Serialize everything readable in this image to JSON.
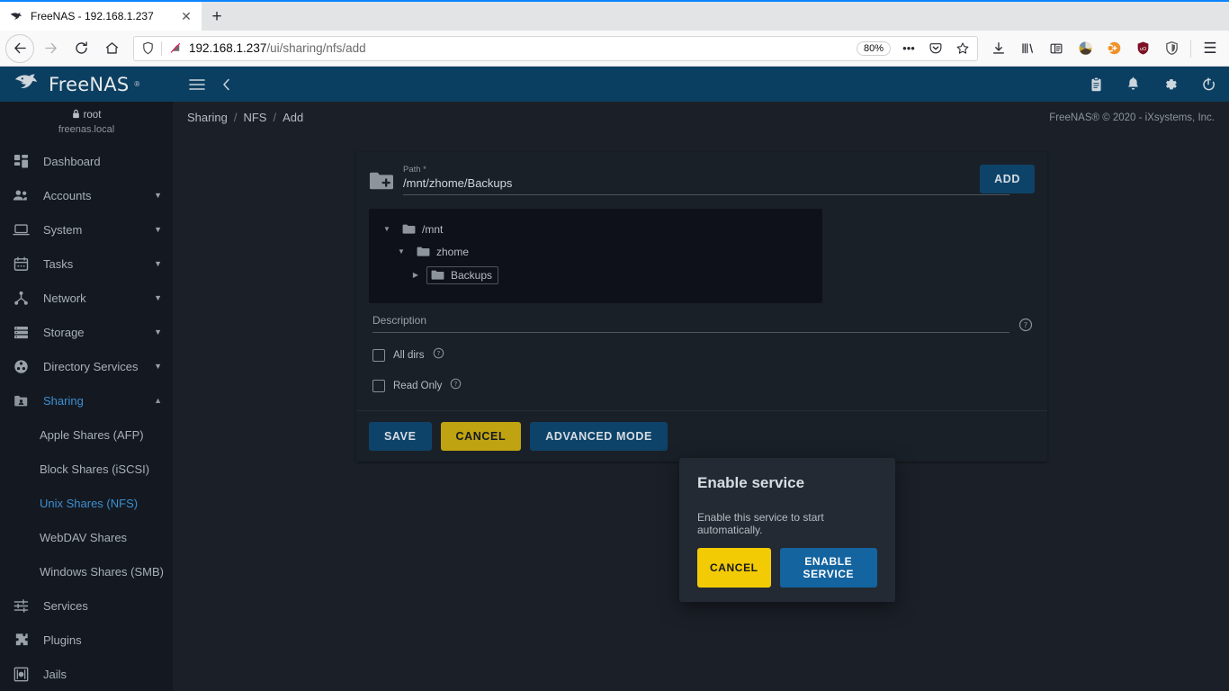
{
  "browser": {
    "tab": {
      "title": "FreeNAS - 192.168.1.237",
      "favicon": "freenas-favicon",
      "close_label": "✕"
    },
    "new_tab_label": "+",
    "nav": {
      "back": "←",
      "forward": "→",
      "reload": "⟳",
      "home": "⌂"
    },
    "url": {
      "host": "192.168.1.237",
      "path": "/ui/sharing/nfs/add",
      "zoom": "80%"
    },
    "urlbar_buttons": {
      "more": "•••",
      "pocket": "pocket-icon",
      "bookmark": "star-icon"
    },
    "toolbar_icons": [
      "download-icon",
      "library-icon",
      "sidebar-icon",
      "account-avatar-icon",
      "container-icon",
      "ublock-icon",
      "shield-addon-icon"
    ],
    "menu_label": "☰"
  },
  "app": {
    "brand": "FreeNAS",
    "topbar": {
      "menu_icon": "hamburger-menu-icon",
      "collapse_icon": "chevron-left-icon",
      "right_icons": [
        "clipboard-icon",
        "bell-icon",
        "gear-icon",
        "power-icon"
      ]
    },
    "user": {
      "name": "root",
      "host": "freenas.local",
      "lock_icon": "lock-icon"
    },
    "breadcrumb": [
      "Sharing",
      "NFS",
      "Add"
    ],
    "breadcrumb_separator": "/",
    "copyright": "FreeNAS® © 2020 - iXsystems, Inc.",
    "colors": {
      "header_blue": "#0b3f61",
      "accent_blue": "#3d8fd1",
      "yellow": "#bfa310",
      "modal_yellow": "#f2cb05",
      "modal_blue": "#1464a0"
    }
  },
  "sidebar": {
    "items": [
      {
        "label": "Dashboard",
        "icon": "dashboard-icon",
        "expandable": false,
        "active": false
      },
      {
        "label": "Accounts",
        "icon": "accounts-icon",
        "expandable": true,
        "active": false
      },
      {
        "label": "System",
        "icon": "system-icon",
        "expandable": true,
        "active": false
      },
      {
        "label": "Tasks",
        "icon": "tasks-calendar-icon",
        "expandable": true,
        "active": false
      },
      {
        "label": "Network",
        "icon": "network-icon",
        "expandable": true,
        "active": false
      },
      {
        "label": "Storage",
        "icon": "storage-icon",
        "expandable": true,
        "active": false
      },
      {
        "label": "Directory Services",
        "icon": "directory-services-icon",
        "expandable": true,
        "active": false
      },
      {
        "label": "Sharing",
        "icon": "sharing-icon",
        "expandable": true,
        "active": true
      }
    ],
    "sharing_children": [
      {
        "label": "Apple Shares (AFP)",
        "active": false
      },
      {
        "label": "Block Shares (iSCSI)",
        "active": false
      },
      {
        "label": "Unix Shares (NFS)",
        "active": true
      },
      {
        "label": "WebDAV Shares",
        "active": false
      },
      {
        "label": "Windows Shares (SMB)",
        "active": false
      }
    ],
    "items_after": [
      {
        "label": "Services",
        "icon": "services-sliders-icon"
      },
      {
        "label": "Plugins",
        "icon": "plugins-puzzle-icon"
      },
      {
        "label": "Jails",
        "icon": "jails-icon"
      }
    ],
    "caret_down": "▼",
    "caret_up": "▲"
  },
  "form": {
    "path": {
      "label": "Path *",
      "value": "/mnt/zhome/Backups",
      "icon": "folder-plus-icon",
      "help_icon": "help-circle-icon"
    },
    "add_button": "ADD",
    "tree": [
      {
        "label": "/mnt",
        "depth": 0,
        "arrow": "▼",
        "expanded": true,
        "selected": false
      },
      {
        "label": "zhome",
        "depth": 1,
        "arrow": "▼",
        "expanded": true,
        "selected": false
      },
      {
        "label": "Backups",
        "depth": 2,
        "arrow": "▶",
        "expanded": false,
        "selected": true
      }
    ],
    "description": {
      "placeholder": "Description",
      "value": "",
      "help_icon": "help-circle-icon"
    },
    "checkboxes": [
      {
        "label": "All dirs",
        "checked": false,
        "help_icon": "help-circle-icon"
      },
      {
        "label": "Read Only",
        "checked": false,
        "help_icon": "help-circle-icon"
      }
    ],
    "actions": [
      {
        "label": "SAVE",
        "style": "blue"
      },
      {
        "label": "CANCEL",
        "style": "yellow"
      },
      {
        "label": "ADVANCED MODE",
        "style": "blue"
      }
    ]
  },
  "modal": {
    "title": "Enable service",
    "message": "Enable this service to start automatically.",
    "cancel_label": "CANCEL",
    "confirm_label": "ENABLE SERVICE"
  }
}
